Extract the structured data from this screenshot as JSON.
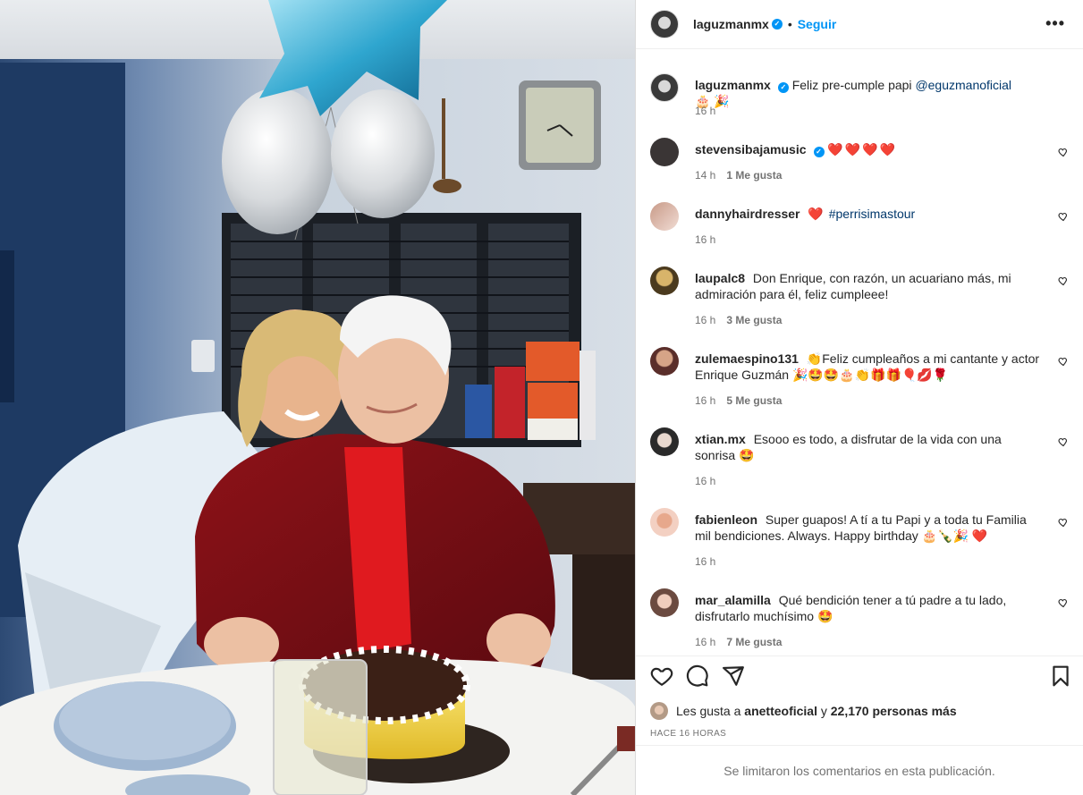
{
  "post": {
    "author": "laguzmanmx",
    "follow_label": "Seguir",
    "dot": "•",
    "more": "•••",
    "caption_user": "laguzmanmx",
    "caption_text": "Feliz pre-cumple papi",
    "caption_mention": "@eguzmanoficial",
    "caption_emoji": "🎂 🎉",
    "caption_time": "16 h"
  },
  "comments": [
    {
      "user": "stevensibajamusic",
      "verified": true,
      "text": "",
      "emoji": "❤️❤️❤️❤️",
      "time": "14 h",
      "likes": "1 Me gusta"
    },
    {
      "user": "dannyhairdresser",
      "text": "",
      "emoji": "❤️",
      "tag": "#perrisimastour",
      "time": "16 h",
      "likes": ""
    },
    {
      "user": "laupalc8",
      "text": "Don Enrique, con razón, un acuariano más, mi admiración para él, feliz cumpleee!",
      "emoji": "",
      "time": "16 h",
      "likes": "3 Me gusta"
    },
    {
      "user": "zulemaespino131",
      "text": "👏Feliz cumpleaños a mi cantante y actor Enrique Guzmán",
      "emoji": "🎉🤩🤩🎂👏🎁🎁🎈💋🌹",
      "time": "16 h",
      "likes": "5 Me gusta"
    },
    {
      "user": "xtian.mx",
      "text": "Esooo es todo, a disfrutar de la vida con una sonrisa",
      "emoji": "🤩",
      "time": "16 h",
      "likes": ""
    },
    {
      "user": "fabienleon",
      "text": "Super guapos! A tí a tu Papi y a toda tu Familia mil bendiciones. Always. Happy birthday",
      "emoji": "🎂🍾🎉 ❤️",
      "time": "16 h",
      "likes": ""
    },
    {
      "user": "mar_alamilla",
      "text": "Qué bendición tener a tú padre a tu lado, disfrutarlo muchísimo",
      "emoji": "🤩",
      "time": "16 h",
      "likes": "7 Me gusta"
    }
  ],
  "likes_line": {
    "prefix": "Les gusta a",
    "user": "anetteoficial",
    "middle": "y",
    "count": "22,170 personas más"
  },
  "time_ago": "HACE 16 HORAS",
  "footer": "Se limitaron los comentarios en esta publicación.",
  "colors": {
    "accent": "#0095f6",
    "text": "#262626",
    "muted": "#737373",
    "heart": "#ed4956"
  }
}
